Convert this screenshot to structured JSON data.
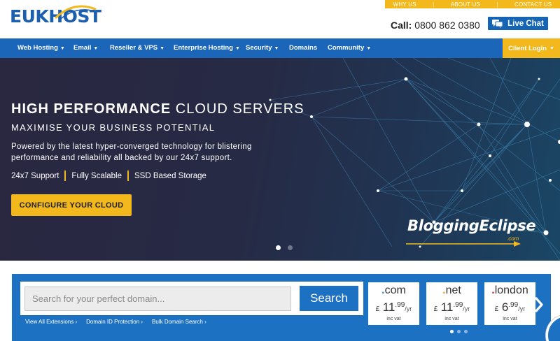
{
  "header": {
    "logo_text": "EUKHOST",
    "top_links": [
      "WHY US",
      "ABOUT US",
      "CONTACT US"
    ],
    "call_label": "Call:",
    "call_number": "0800 862 0380",
    "live_chat_label": "Live Chat"
  },
  "nav": {
    "items": [
      {
        "label": "Web Hosting",
        "dropdown": true
      },
      {
        "label": "Email",
        "dropdown": true
      },
      {
        "label": "Reseller & VPS",
        "dropdown": true
      },
      {
        "label": "Enterprise Hosting",
        "dropdown": true
      },
      {
        "label": "Security",
        "dropdown": true
      },
      {
        "label": "Domains",
        "dropdown": false
      },
      {
        "label": "Community",
        "dropdown": true
      }
    ],
    "client_login_label": "Client Login"
  },
  "hero": {
    "title_bold": "HIGH PERFORMANCE",
    "title_rest": "CLOUD SERVERS",
    "subtitle": "MAXIMISE YOUR BUSINESS POTENTIAL",
    "description": "Powered by the latest hyper-converged technology for blistering performance and reliability all backed by our 24x7 support.",
    "features": [
      "24x7 Support",
      "Fully Scalable",
      "SSD Based Storage"
    ],
    "cta_label": "CONFIGURE YOUR CLOUD",
    "watermark_text": "BloggingEclipse",
    "watermark_suffix": ".com",
    "slides_total": 2,
    "slide_active": 1
  },
  "domain_search": {
    "placeholder": "Search for your perfect domain...",
    "search_label": "Search",
    "links": [
      "View All Extensions ›",
      "Domain ID Protection ›",
      "Bulk Domain Search ›"
    ],
    "tlds": [
      {
        "name": "com",
        "currency": "£",
        "price_main": "11",
        "price_dec": ".99",
        "period": "/yr",
        "vat": "inc vat",
        "dot_color": "#1d8fe0"
      },
      {
        "name": "net",
        "currency": "£",
        "price_main": "11",
        "price_dec": ".99",
        "period": "/yr",
        "vat": "inc vat",
        "dot_color": "#f3a21c"
      },
      {
        "name": "london",
        "currency": "£",
        "price_main": "6",
        "price_dec": ".99",
        "period": "/yr",
        "vat": "inc vat",
        "dot_color": "#d8262f"
      }
    ],
    "carousel_pages": 3,
    "carousel_active": 1
  },
  "colors": {
    "brand_blue": "#1b66b8",
    "accent_yellow": "#f3b81c",
    "hero_dark": "#272a42"
  }
}
